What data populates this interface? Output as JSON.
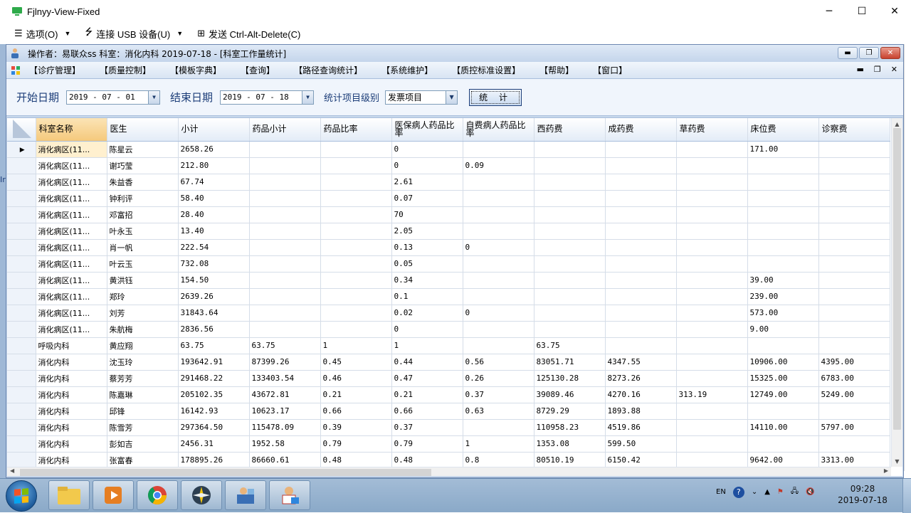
{
  "viewer": {
    "title": "Fjlnyy-View-Fixed",
    "toolbar": {
      "options_label": "选项(O)",
      "usb_label": "连接 USB 设备(U)",
      "cad_label": "发送 Ctrl-Alt-Delete(C)"
    },
    "left_strip_text": "Ir"
  },
  "app": {
    "title": "操作者：易联众ss   科室：消化内科   2019-07-18 - [科室工作量统计]",
    "menus": [
      "【诊疗管理】",
      "【质量控制】",
      "【模板字典】",
      "【查询】",
      "【路径查询统计】",
      "【系统维护】",
      "【质控标准设置】",
      "【帮助】",
      "【窗口】"
    ],
    "filter": {
      "start_label": "开始日期",
      "start_value": "2019 - 07 - 01",
      "end_label": "结束日期",
      "end_value": "2019 - 07 - 18",
      "level_label": "统计项目级别",
      "level_value": "发票项目",
      "stat_button": "统 计"
    }
  },
  "grid": {
    "columns": [
      "科室名称",
      "医生",
      "小计",
      "药品小计",
      "药品比率",
      "医保病人药品比率",
      "自费病人药品比率",
      "西药费",
      "成药费",
      "草药费",
      "床位费",
      "诊察费"
    ],
    "rows": [
      [
        "消化病区(11...",
        "陈星云",
        "2658.26",
        "",
        "",
        "0",
        "",
        "",
        "",
        "",
        "171.00",
        ""
      ],
      [
        "消化病区(11...",
        "谢巧莹",
        "212.80",
        "",
        "",
        "0",
        "0.09",
        "",
        "",
        "",
        "",
        ""
      ],
      [
        "消化病区(11...",
        "朱益香",
        "67.74",
        "",
        "",
        "2.61",
        "",
        "",
        "",
        "",
        "",
        ""
      ],
      [
        "消化病区(11...",
        "钟利评",
        "58.40",
        "",
        "",
        "0.07",
        "",
        "",
        "",
        "",
        "",
        ""
      ],
      [
        "消化病区(11...",
        "邓富招",
        "28.40",
        "",
        "",
        "70",
        "",
        "",
        "",
        "",
        "",
        ""
      ],
      [
        "消化病区(11...",
        "叶永玉",
        "13.40",
        "",
        "",
        "2.05",
        "",
        "",
        "",
        "",
        "",
        ""
      ],
      [
        "消化病区(11...",
        "肖一帆",
        "222.54",
        "",
        "",
        "0.13",
        "0",
        "",
        "",
        "",
        "",
        ""
      ],
      [
        "消化病区(11...",
        "叶云玉",
        "732.08",
        "",
        "",
        "0.05",
        "",
        "",
        "",
        "",
        "",
        ""
      ],
      [
        "消化病区(11...",
        "黄洪钰",
        "154.50",
        "",
        "",
        "0.34",
        "",
        "",
        "",
        "",
        "39.00",
        ""
      ],
      [
        "消化病区(11...",
        "郑玲",
        "2639.26",
        "",
        "",
        "0.1",
        "",
        "",
        "",
        "",
        "239.00",
        ""
      ],
      [
        "消化病区(11...",
        "刘芳",
        "31843.64",
        "",
        "",
        "0.02",
        "0",
        "",
        "",
        "",
        "573.00",
        ""
      ],
      [
        "消化病区(11...",
        "朱航梅",
        "2836.56",
        "",
        "",
        "0",
        "",
        "",
        "",
        "",
        "9.00",
        ""
      ],
      [
        "呼吸内科",
        "黄应翔",
        "63.75",
        "63.75",
        "1",
        "1",
        "",
        "63.75",
        "",
        "",
        "",
        ""
      ],
      [
        "消化内科",
        "沈玉玲",
        "193642.91",
        "87399.26",
        "0.45",
        "0.44",
        "0.56",
        "83051.71",
        "4347.55",
        "",
        "10906.00",
        "4395.00"
      ],
      [
        "消化内科",
        "蔡芳芳",
        "291468.22",
        "133403.54",
        "0.46",
        "0.47",
        "0.26",
        "125130.28",
        "8273.26",
        "",
        "15325.00",
        "6783.00"
      ],
      [
        "消化内科",
        "陈嘉琳",
        "205102.35",
        "43672.81",
        "0.21",
        "0.21",
        "0.37",
        "39089.46",
        "4270.16",
        "313.19",
        "12749.00",
        "5249.00"
      ],
      [
        "消化内科",
        "邱锋",
        "16142.93",
        "10623.17",
        "0.66",
        "0.66",
        "0.63",
        "8729.29",
        "1893.88",
        "",
        "",
        ""
      ],
      [
        "消化内科",
        "陈雪芳",
        "297364.50",
        "115478.09",
        "0.39",
        "0.37",
        "",
        "110958.23",
        "4519.86",
        "",
        "14110.00",
        "5797.00"
      ],
      [
        "消化内科",
        "彭如吉",
        "2456.31",
        "1952.58",
        "0.79",
        "0.79",
        "1",
        "1353.08",
        "599.50",
        "",
        "",
        ""
      ],
      [
        "消化内科",
        "张富春",
        "178895.26",
        "86660.61",
        "0.48",
        "0.48",
        "0.8",
        "80510.19",
        "6150.42",
        "",
        "9642.00",
        "3313.00"
      ]
    ]
  },
  "taskbar": {
    "lang": "EN",
    "time": "09:28",
    "date": "2019-07-18"
  }
}
